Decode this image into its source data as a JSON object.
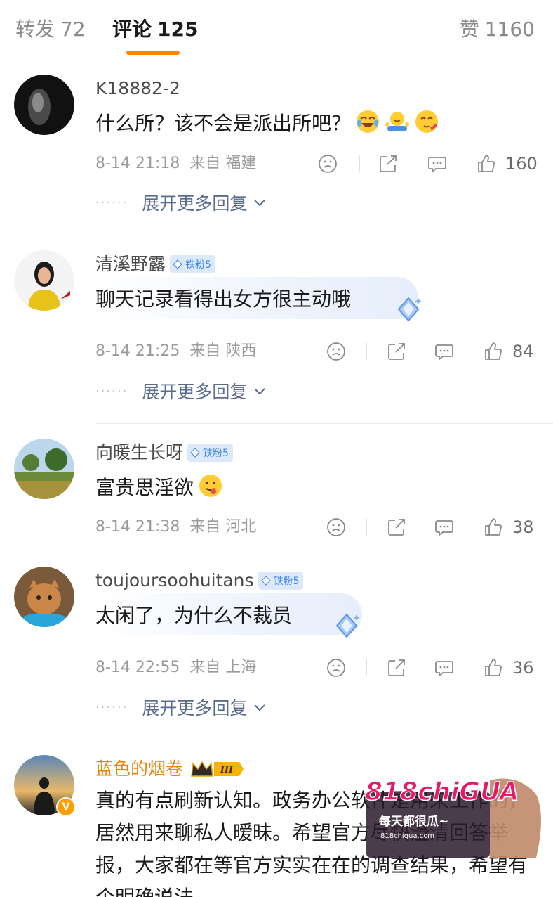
{
  "tabs": {
    "repost": {
      "label": "转发",
      "count": "72"
    },
    "comments": {
      "label": "评论",
      "count": "125"
    },
    "likes": {
      "label": "赞",
      "count": "1160"
    }
  },
  "expand_label": "展开更多回复",
  "comments": [
    {
      "user": "K18882-2",
      "text": "什么所？该不会是派出所吧？",
      "time": "8-14 21:18",
      "from": "来自 福建",
      "likes": "160"
    },
    {
      "user": "清溪野露",
      "badge": "铁粉5",
      "text": "聊天记录看得出女方很主动哦",
      "time": "8-14 21:25",
      "from": "来自 陕西",
      "likes": "84"
    },
    {
      "user": "向暖生长呀",
      "badge": "铁粉5",
      "text": "富贵思淫欲",
      "time": "8-14 21:38",
      "from": "来自 河北",
      "likes": "38"
    },
    {
      "user": "toujoursoohuitans",
      "badge": "铁粉5",
      "text": "太闲了，为什么不裁员",
      "time": "8-14 22:55",
      "from": "来自 上海",
      "likes": "36"
    },
    {
      "user": "蓝色的烟卷",
      "crown_level": "III",
      "text": "真的有点刷新认知。政务办公软件是用来工作的，居然用来聊私人暧昧。希望官方尽快澄清回答举报，大家都在等官方实实在在的调查结果，希望有个明确说法"
    }
  ],
  "watermark": {
    "brand": "818chiGUA",
    "slogan": "每天都很瓜~",
    "domain": "818chigua.com"
  },
  "colors": {
    "accent": "#ff8200",
    "link": "#5a6c8c",
    "fan_badge": "#3f86e8",
    "vip_name": "#e8830e"
  }
}
